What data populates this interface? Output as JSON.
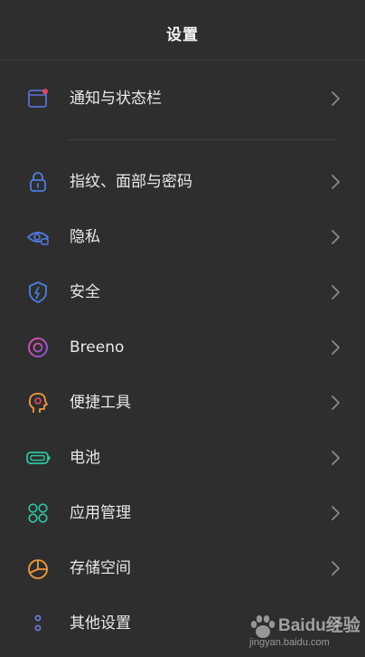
{
  "header": {
    "title": "设置"
  },
  "items": [
    {
      "label": "通知与状态栏",
      "icon": "notification-statusbar-icon",
      "color": "#5b6fd6"
    },
    {
      "label": "指纹、面部与密码",
      "icon": "lock-icon",
      "color": "#4e7de0"
    },
    {
      "label": "隐私",
      "icon": "eye-privacy-icon",
      "color": "#4e7de0"
    },
    {
      "label": "安全",
      "icon": "shield-bolt-icon",
      "color": "#4e7de0"
    },
    {
      "label": "Breeno",
      "icon": "breeno-ring-icon",
      "color": "#c34dd8"
    },
    {
      "label": "便捷工具",
      "icon": "head-gear-icon",
      "color": "#f09a3a"
    },
    {
      "label": "电池",
      "icon": "battery-icon",
      "color": "#2fc4a0"
    },
    {
      "label": "应用管理",
      "icon": "apps-grid-icon",
      "color": "#2fc4a0"
    },
    {
      "label": "存储空间",
      "icon": "pie-storage-icon",
      "color": "#f09a3a"
    },
    {
      "label": "其他设置",
      "icon": "dots-icon",
      "color": "#6c7ee6"
    }
  ],
  "watermark": {
    "brand": "Baidu经验",
    "url": "jingyan.baidu.com"
  }
}
